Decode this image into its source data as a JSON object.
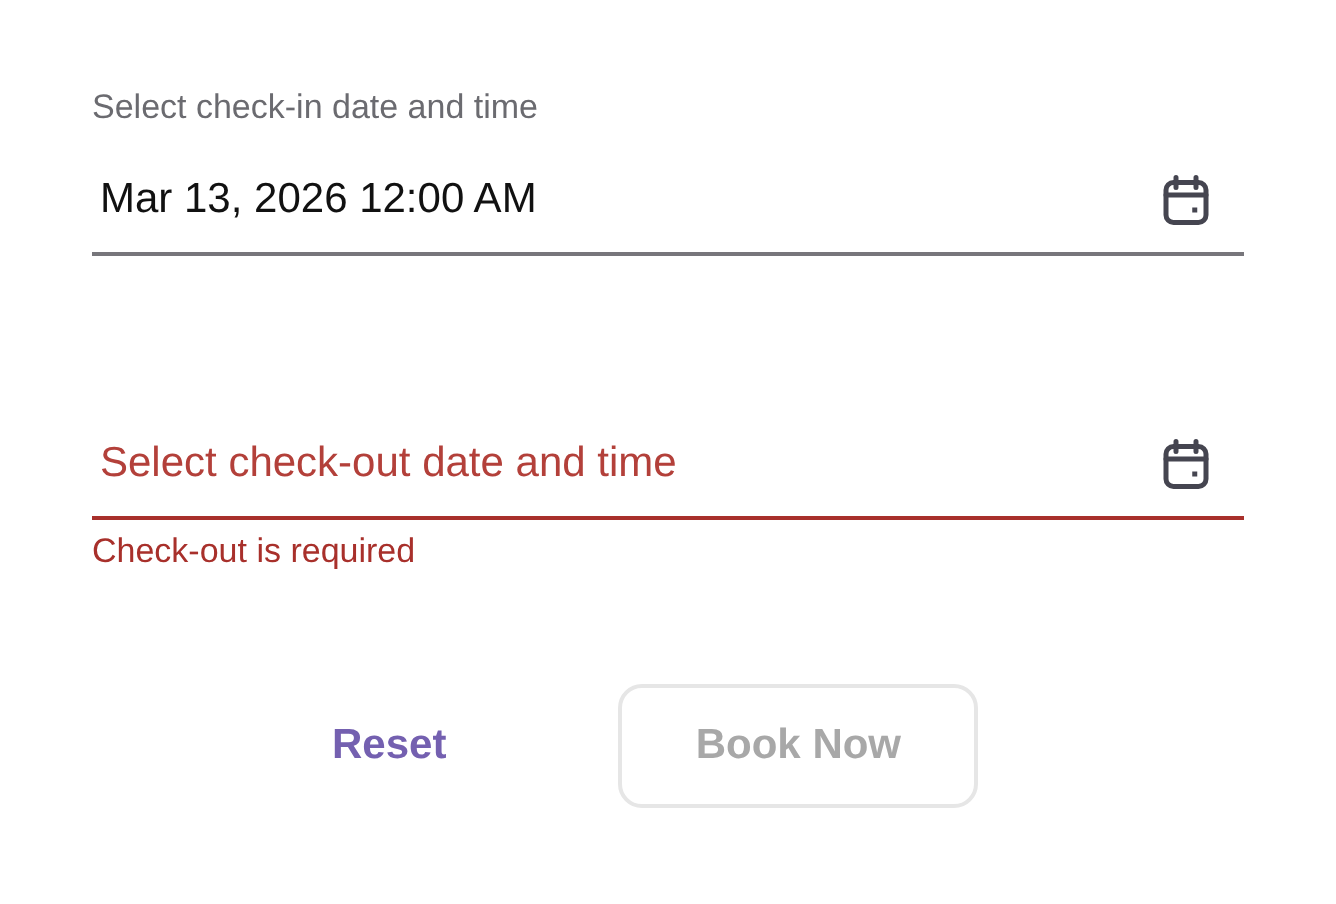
{
  "fields": [
    {
      "label": "Select check-in date and time",
      "value": "Mar 13, 2026 12:00 AM",
      "invalid": false
    },
    {
      "placeholder": "Select check-out date and time",
      "invalid": true,
      "error": "Check-out is required"
    }
  ],
  "buttons": [
    {
      "label": "Reset",
      "kind": "text",
      "disabled": false
    },
    {
      "label": "Book Now",
      "kind": "outlined",
      "disabled": true
    }
  ]
}
